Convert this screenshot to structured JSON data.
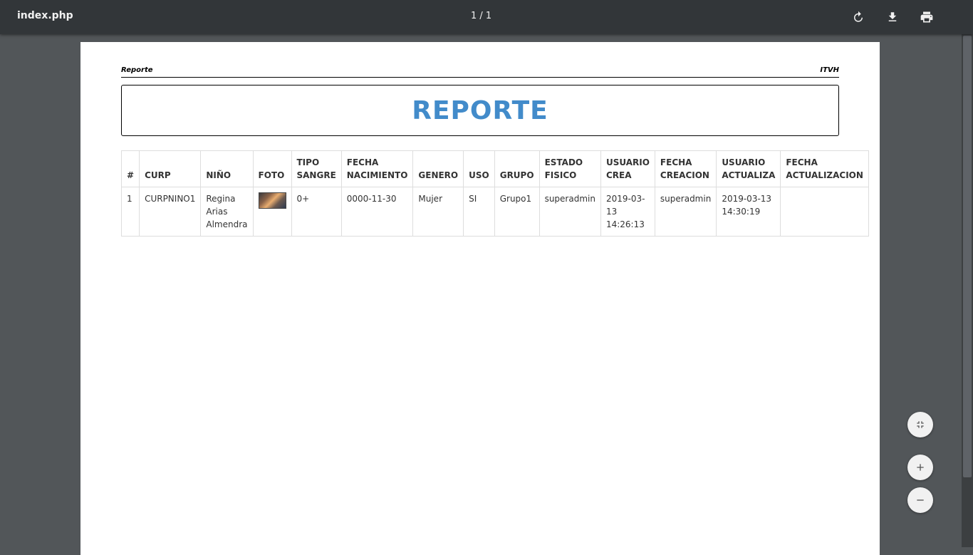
{
  "toolbar": {
    "title": "index.php",
    "page_count": "1 / 1",
    "rotate_icon": "rotate-icon",
    "download_icon": "download-icon",
    "print_icon": "print-icon"
  },
  "page": {
    "header_left": "Reporte",
    "header_right": "ITVH",
    "title": "REPORTE"
  },
  "table": {
    "headers": [
      "#",
      "CURP",
      "NIÑO",
      "FOTO",
      "TIPO SANGRE",
      "FECHA NACIMIENTO",
      "GENERO",
      "USO",
      "GRUPO",
      "ESTADO FISICO",
      "USUARIO CREA",
      "FECHA CREACION",
      "USUARIO ACTUALIZA",
      "FECHA ACTUALIZACION"
    ],
    "rows": [
      {
        "num": "1",
        "curp": "CURPNINO1",
        "nino": "Regina Arias Almendra",
        "foto": "photo-thumbnail",
        "tipo_sangre": "0+",
        "fecha_nacimiento": "0000-11-30",
        "genero": "Mujer",
        "uso": "SI",
        "grupo": "Grupo1",
        "estado_fisico": "superadmin",
        "usuario_crea": "2019-03-13 14:26:13",
        "fecha_creacion": "superadmin",
        "usuario_actualiza": "2019-03-13 14:30:19",
        "fecha_actualizacion": ""
      }
    ]
  },
  "zoom": {
    "fit_icon": "fit-to-page-icon",
    "zoom_in_icon": "zoom-in-icon",
    "zoom_out_icon": "zoom-out-icon"
  }
}
